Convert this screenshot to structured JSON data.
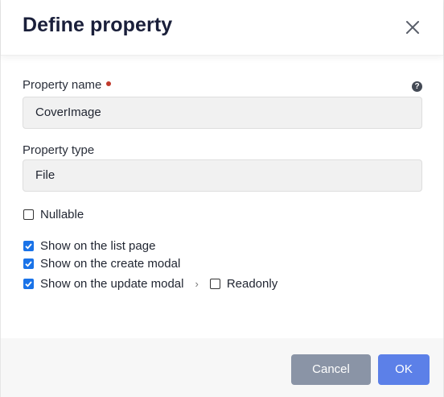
{
  "dialog": {
    "title": "Define property"
  },
  "fields": {
    "property_name": {
      "label": "Property name",
      "value": "CoverImage",
      "help_icon": "?"
    },
    "property_type": {
      "label": "Property type",
      "value": "File"
    }
  },
  "options": {
    "nullable": {
      "label": "Nullable",
      "checked": false
    },
    "show_on_list_page": {
      "label": "Show on the list page",
      "checked": true
    },
    "show_on_create_modal": {
      "label": "Show on the create modal",
      "checked": true
    },
    "show_on_update_modal": {
      "label": "Show on the update modal",
      "checked": true
    },
    "readonly": {
      "label": "Readonly",
      "checked": false
    },
    "chevron": "›"
  },
  "buttons": {
    "cancel": "Cancel",
    "ok": "OK"
  },
  "colors": {
    "accent": "#1a73e8",
    "ok_button": "#5c80e8",
    "cancel_button": "#8a94a6",
    "required_dot": "#c0392b"
  },
  "icons": {
    "close": "close-icon",
    "help": "help-icon",
    "check": "check-icon",
    "chevron": "chevron-right-icon"
  }
}
